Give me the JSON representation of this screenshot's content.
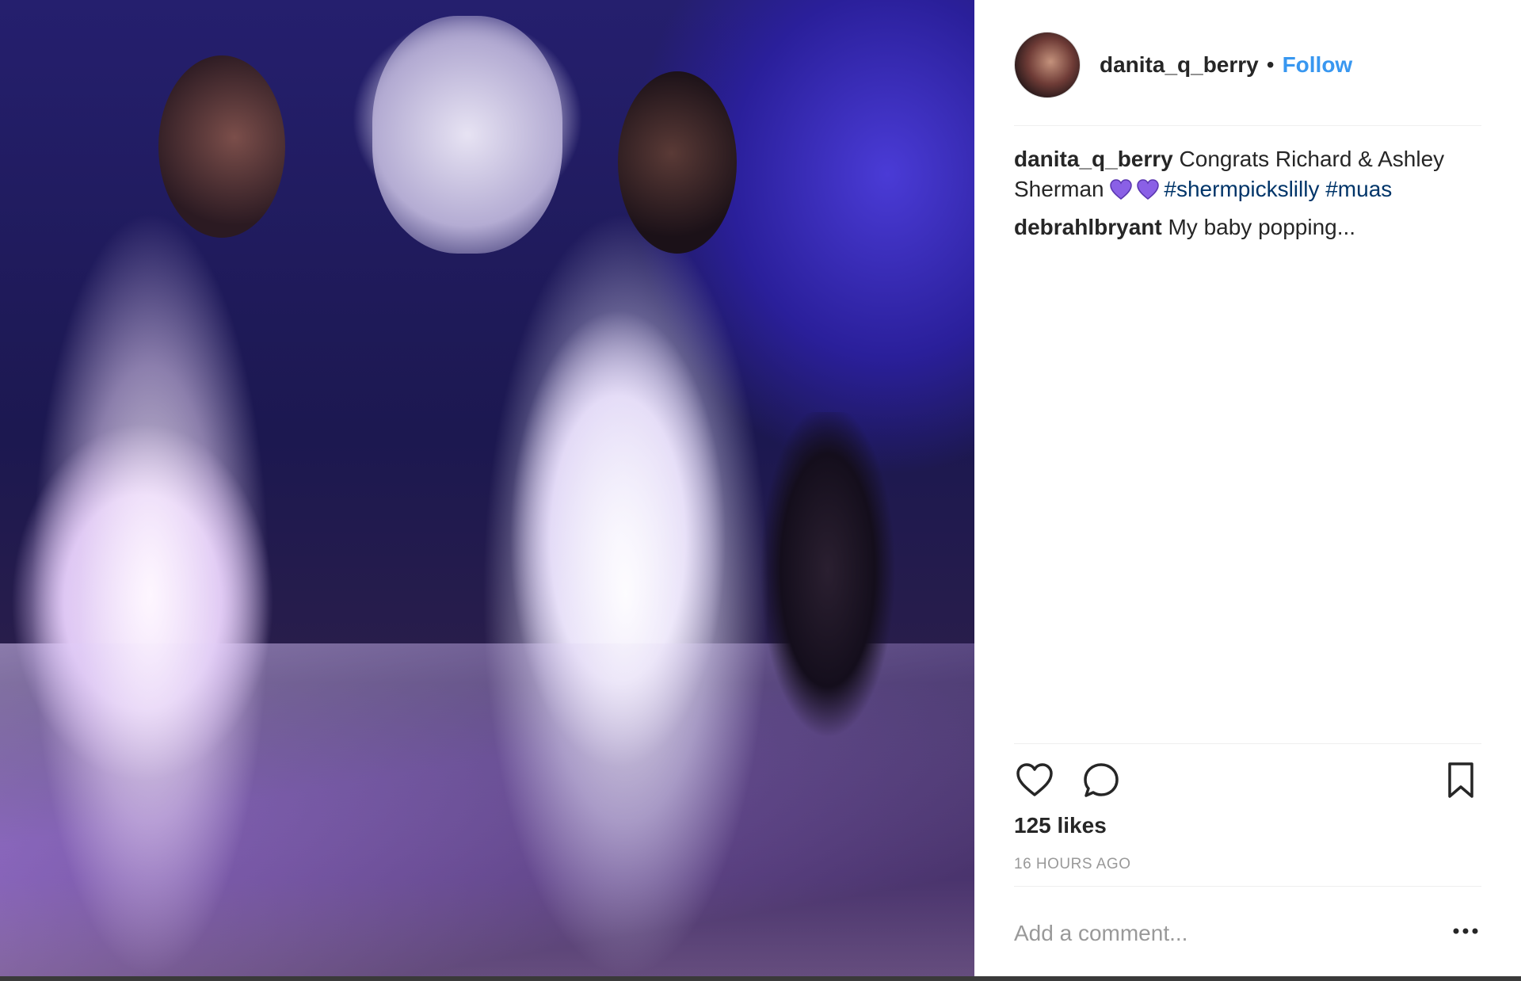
{
  "post": {
    "username": "danita_q_berry",
    "separator": "•",
    "follow_label": "Follow"
  },
  "caption": {
    "username": "danita_q_berry",
    "text": "Congrats Richard & Ashley Sherman",
    "hashtags": [
      "#shermpickslilly",
      "#muas"
    ],
    "emoji": [
      "purple-heart-icon",
      "purple-heart-icon"
    ],
    "heart_color": "#8a60e6"
  },
  "comments": [
    {
      "username": "debrahlbryant",
      "text": "My baby popping..."
    }
  ],
  "stats": {
    "likes": "125 likes",
    "timestamp": "16 HOURS AGO"
  },
  "comment_box": {
    "placeholder": "Add a comment..."
  },
  "colors": {
    "link": "#3897f0",
    "hashtag": "#003569",
    "muted": "#999999"
  }
}
